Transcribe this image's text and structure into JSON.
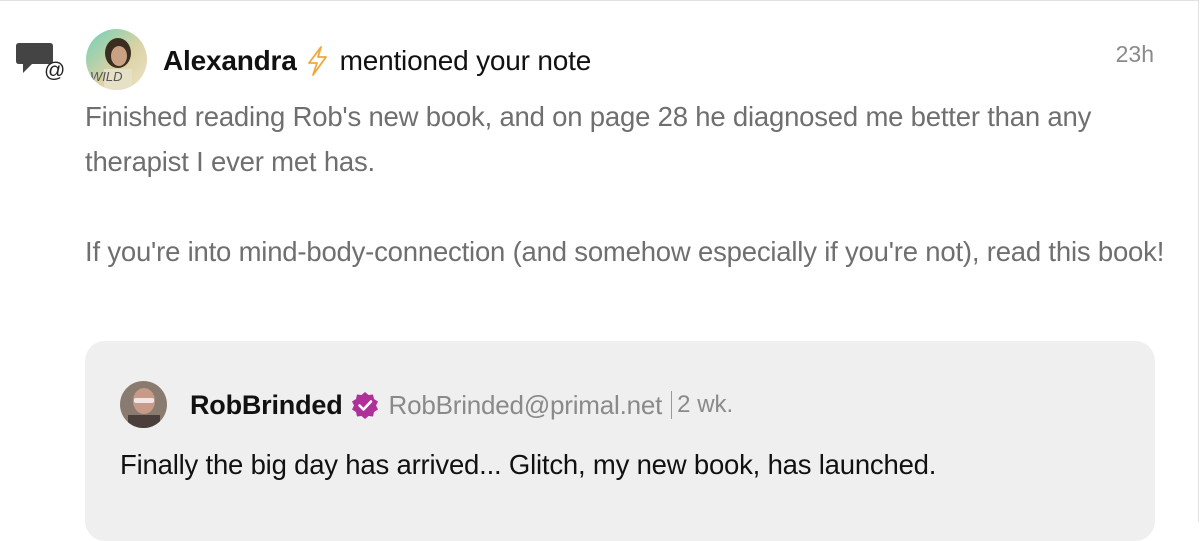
{
  "notification": {
    "type_icon": "mention-notification-icon",
    "author": {
      "name": "Alexandra",
      "avatar_icon": "user-avatar",
      "badge_icon": "lightning-bolt-icon"
    },
    "action": "mentioned your note",
    "time": "23h",
    "body": {
      "paragraph_1": "Finished reading Rob's new book, and on page 28 he diagnosed me better than any therapist I ever met has.",
      "paragraph_2": "If you're into mind-body-connection (and somehow especially if you're not), read this book!"
    }
  },
  "quoted_note": {
    "author": "RobBrinded",
    "avatar_icon": "user-avatar",
    "verified_icon": "verified-badge-icon",
    "handle": "RobBrinded@primal.net",
    "time": "2 wk.",
    "text": "Finally the big day has arrived... Glitch, my new book, has launched."
  },
  "colors": {
    "primary_text": "#111111",
    "secondary_text": "#6f6f6f",
    "muted_text": "#8a8a8a",
    "quote_background": "#efefef",
    "zap_accent": "#f0a83c",
    "verified_accent": "#b0309a"
  }
}
